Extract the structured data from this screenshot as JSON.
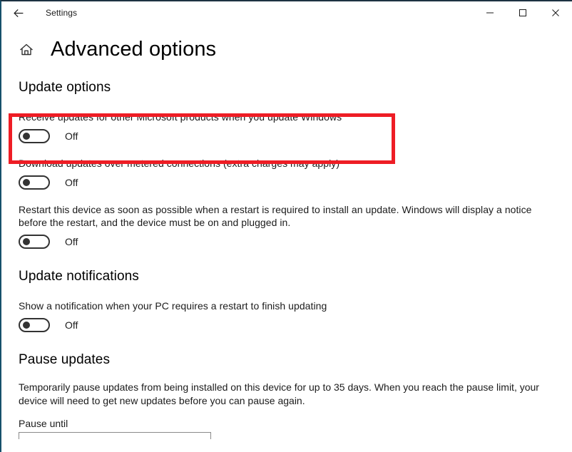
{
  "window": {
    "titlebar_title": "Settings",
    "back_icon": "back-arrow-icon",
    "minimize_icon": "minimize-icon",
    "maximize_icon": "maximize-icon",
    "close_icon": "close-icon"
  },
  "header": {
    "home_icon": "home-icon",
    "title": "Advanced options"
  },
  "sections": {
    "update_options": {
      "heading": "Update options",
      "options": [
        {
          "label": "Receive updates for other Microsoft products when you update Windows",
          "state": "Off",
          "highlighted": true
        },
        {
          "label": "Download updates over metered connections (extra charges may apply)",
          "state": "Off",
          "highlighted": false
        },
        {
          "label": "Restart this device as soon as possible when a restart is required to install an update. Windows will display a notice before the restart, and the device must be on and plugged in.",
          "state": "Off",
          "highlighted": false
        }
      ]
    },
    "update_notifications": {
      "heading": "Update notifications",
      "options": [
        {
          "label": "Show a notification when your PC requires a restart to finish updating",
          "state": "Off"
        }
      ]
    },
    "pause_updates": {
      "heading": "Pause updates",
      "description": "Temporarily pause updates from being installed on this device for up to 35 days. When you reach the pause limit, your device will need to get new updates before you can pause again.",
      "pause_until_label": "Pause until"
    }
  },
  "colors": {
    "highlight": "#ee1d25",
    "text": "#1b1b1b",
    "toggle_outline": "#333333"
  }
}
